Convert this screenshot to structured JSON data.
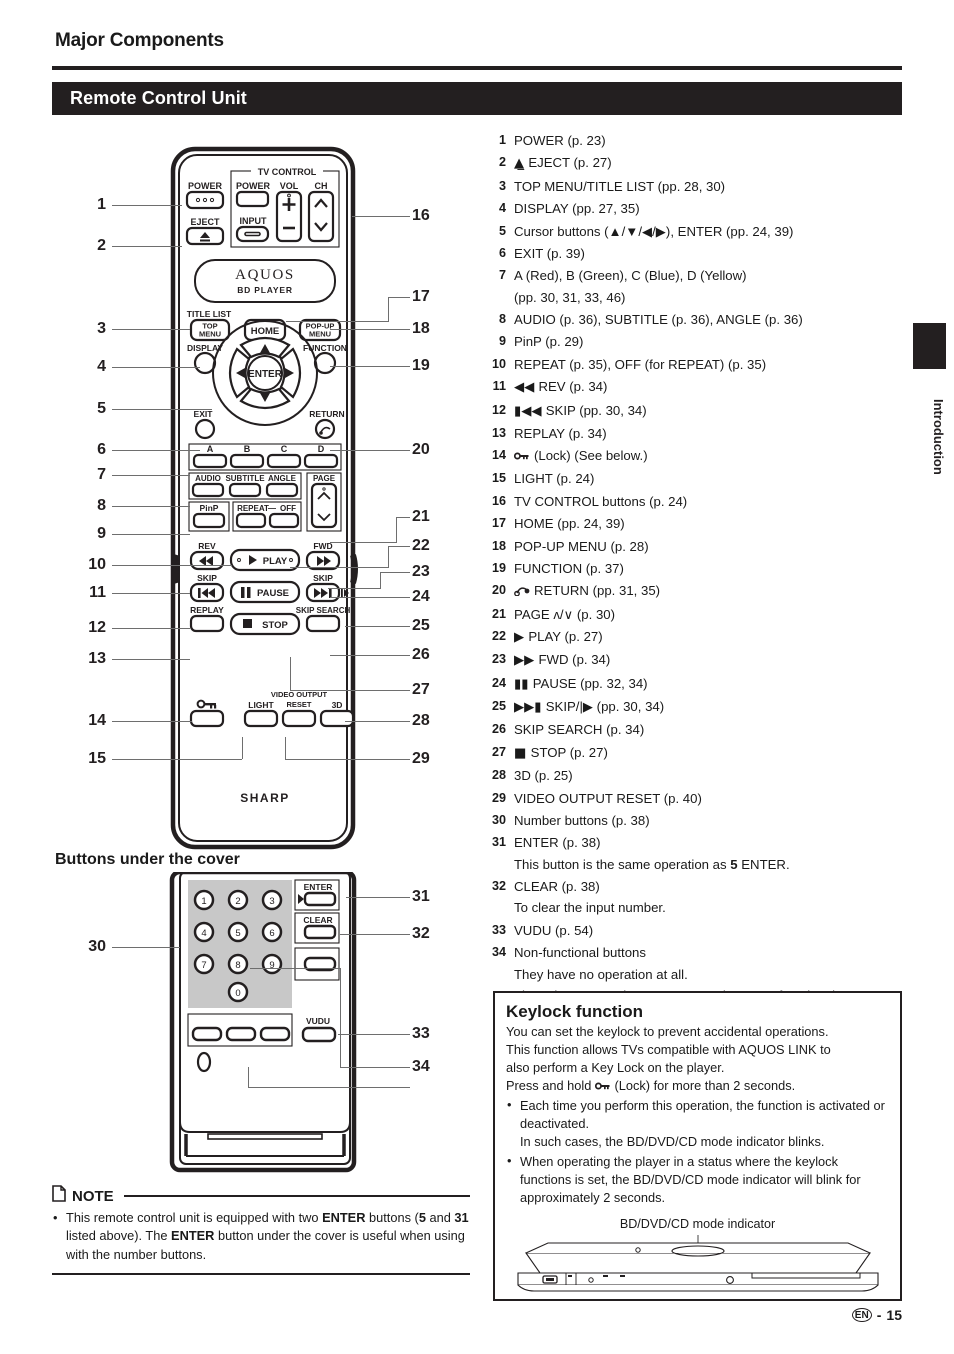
{
  "header": {
    "major_title": "Major Components",
    "section_title": "Remote Control Unit"
  },
  "side_tab": {
    "label": "Introduction"
  },
  "sub_heading": "Buttons under the cover",
  "reference_list": [
    {
      "num": "1",
      "text": "POWER (p. 23)"
    },
    {
      "num": "2",
      "icon": "eject",
      "text": "EJECT (p. 27)"
    },
    {
      "num": "3",
      "text": "TOP MENU/TITLE LIST (pp. 28, 30)"
    },
    {
      "num": "4",
      "text": "DISPLAY (pp. 27, 35)"
    },
    {
      "num": "5",
      "text": "Cursor buttons (▲/▼/◀/▶), ENTER (pp. 24, 39)"
    },
    {
      "num": "6",
      "text": "EXIT (p. 39)"
    },
    {
      "num": "7",
      "text": "A (Red), B (Green), C (Blue), D (Yellow)",
      "sub": "(pp. 30, 31, 33, 46)"
    },
    {
      "num": "8",
      "text": "AUDIO (p. 36), SUBTITLE (p. 36), ANGLE (p. 36)"
    },
    {
      "num": "9",
      "text": "PinP (p. 29)"
    },
    {
      "num": "10",
      "text": "REPEAT (p. 35), OFF (for REPEAT) (p. 35)"
    },
    {
      "num": "11",
      "icon": "rev",
      "text": "REV (p. 34)"
    },
    {
      "num": "12",
      "icon": "skip-back",
      "text": "SKIP (pp. 30, 34)"
    },
    {
      "num": "13",
      "text": "REPLAY (p. 34)"
    },
    {
      "num": "14",
      "icon": "lock",
      "text": "(Lock) (See below.)"
    },
    {
      "num": "15",
      "text": "LIGHT (p. 24)"
    },
    {
      "num": "16",
      "text": "TV CONTROL buttons (p. 24)"
    },
    {
      "num": "17",
      "text": "HOME (pp. 24, 39)"
    },
    {
      "num": "18",
      "text": "POP-UP MENU (p. 28)"
    },
    {
      "num": "19",
      "text": "FUNCTION (p. 37)"
    },
    {
      "num": "20",
      "icon": "return",
      "text": "RETURN (pp. 31, 35)"
    },
    {
      "num": "21",
      "icon": "page-updown",
      "text": "PAGE ʌ/∨ (p. 30)"
    },
    {
      "num": "22",
      "icon": "play",
      "text": "PLAY (p. 27)"
    },
    {
      "num": "23",
      "icon": "fwd",
      "text": "FWD (p. 34)"
    },
    {
      "num": "24",
      "icon": "pause",
      "text": "PAUSE (pp. 32, 34)"
    },
    {
      "num": "25",
      "icon": "skip-fwd",
      "text": "SKIP/|▶ (pp. 30, 34)"
    },
    {
      "num": "26",
      "text": "SKIP SEARCH (p. 34)"
    },
    {
      "num": "27",
      "icon": "stop",
      "text": "STOP (p. 27)"
    },
    {
      "num": "28",
      "text": "3D (p. 25)"
    },
    {
      "num": "29",
      "text": "VIDEO OUTPUT RESET (p. 40)"
    },
    {
      "num": "30",
      "text": "Number buttons (p. 38)"
    },
    {
      "num": "31",
      "text": "ENTER (p. 38)",
      "sub": "This button is the same operation as 5 ENTER."
    },
    {
      "num": "32",
      "text": "CLEAR (p. 38)",
      "sub": "To clear the input number."
    },
    {
      "num": "33",
      "text": "VUDU (p. 54)"
    },
    {
      "num": "34",
      "text": "Non-functional buttons",
      "sub": "They have no operation at all.",
      "sub2": "These buttons on the remote control are non-functional."
    }
  ],
  "keylock": {
    "title": "Keylock function",
    "p1": "You can set the keylock to prevent accidental operations.",
    "p2": "This function allows TVs compatible with AQUOS LINK to",
    "p3": "also perform a Key Lock on the player.",
    "p4_pre": "Press and hold ",
    "p4_post": " (Lock) for more than 2 seconds.",
    "bullets": [
      "Each time you perform this operation, the function is activated or deactivated.\nIn such cases, the BD/DVD/CD mode indicator blinks.",
      "When operating the player in a status where the keylock functions is set, the BD/DVD/CD mode indicator will blink for approximately 2 seconds."
    ],
    "indicator_label": "BD/DVD/CD mode indicator"
  },
  "note": {
    "title": "NOTE",
    "body_1": "This remote control unit is equipped with two ",
    "body_b1": "ENTER",
    "body_2": " buttons (",
    "body_b2": "5",
    "body_3": " and ",
    "body_b3": "31",
    "body_4": " listed above). The ",
    "body_b4": "ENTER",
    "body_5": " button under the cover is useful when using with the number buttons."
  },
  "footer": {
    "lang": "EN",
    "dash": "-",
    "page": "15"
  },
  "remote": {
    "brand": "AQUOS",
    "brand_sub": "BD PLAYER",
    "maker": "SHARP",
    "tv_control_label": "TV CONTROL",
    "labels": {
      "power": "POWER",
      "eject": "EJECT",
      "tv_power": "POWER",
      "tv_vol": "VOL",
      "tv_ch": "CH",
      "tv_input": "INPUT",
      "title_list": "TITLE LIST",
      "top_menu_l1": "TOP",
      "top_menu_l2": "MENU",
      "home": "HOME",
      "popup_l1": "POP-UP",
      "popup_l2": "MENU",
      "display": "DISPLAY",
      "function": "FUNCTION",
      "enter": "ENTER",
      "exit": "EXIT",
      "return": "RETURN",
      "a": "A",
      "b": "B",
      "c": "C",
      "d": "D",
      "audio": "AUDIO",
      "subtitle": "SUBTITLE",
      "angle": "ANGLE",
      "page": "PAGE",
      "pinp": "PinP",
      "repeat": "REPEAT",
      "dash": "—",
      "off": "OFF",
      "rev": "REV",
      "fwd": "FWD",
      "play": "PLAY",
      "pause": "PAUSE",
      "stop": "STOP",
      "skip_l": "SKIP",
      "skip_r": "SKIP",
      "replay": "REPLAY",
      "skip_search": "SKIP SEARCH",
      "light": "LIGHT",
      "video_output_l1": "VIDEO OUTPUT",
      "video_output_l2": "RESET",
      "threed": "3D"
    },
    "cover": {
      "numbers": [
        "1",
        "2",
        "3",
        "4",
        "5",
        "6",
        "7",
        "8",
        "9",
        "0"
      ],
      "enter": "ENTER",
      "clear": "CLEAR",
      "vudu": "VUDU"
    }
  },
  "callouts_left": [
    "1",
    "2",
    "3",
    "4",
    "5",
    "6",
    "7",
    "8",
    "9",
    "10",
    "11",
    "12",
    "13",
    "14",
    "15"
  ],
  "callouts_right": [
    "16",
    "17",
    "18",
    "19",
    "20",
    "21",
    "22",
    "23",
    "24",
    "25",
    "26",
    "27",
    "28",
    "29"
  ],
  "callouts_cover_left": [
    "30"
  ],
  "callouts_cover_right": [
    "31",
    "32",
    "33",
    "34"
  ]
}
